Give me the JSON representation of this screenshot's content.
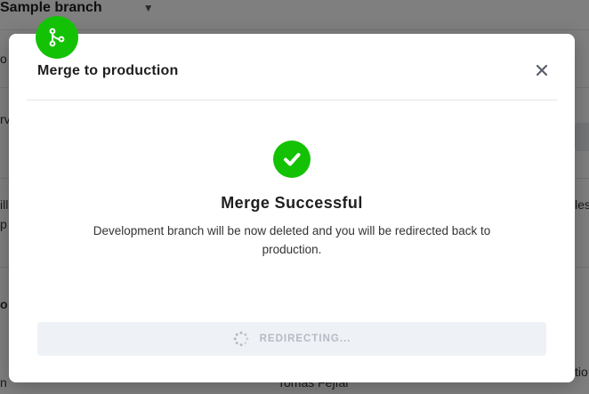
{
  "background": {
    "branch_name": "Sample branch",
    "fragments": {
      "f1": "o",
      "f2": "rv",
      "f3": "ill",
      "f4": "p",
      "f5": "o",
      "f6": "n",
      "f7": "Tomas Fejfar",
      "f8": "les",
      "f9": "tio"
    }
  },
  "modal": {
    "title": "Merge to production",
    "badge_icon": "branch-icon",
    "close_icon": "close-icon",
    "status_icon": "check-circle-icon",
    "heading": "Merge Successful",
    "message": "Development branch will be now deleted and you will be redirected back to production.",
    "button": {
      "label": "REDIRECTING...",
      "icon": "spinner-icon",
      "disabled": true
    }
  },
  "colors": {
    "accent_green": "#13c204",
    "overlay": "rgba(0,0,0,0.5)",
    "button_bg": "#eef1f6",
    "button_text": "#b5bac4"
  }
}
